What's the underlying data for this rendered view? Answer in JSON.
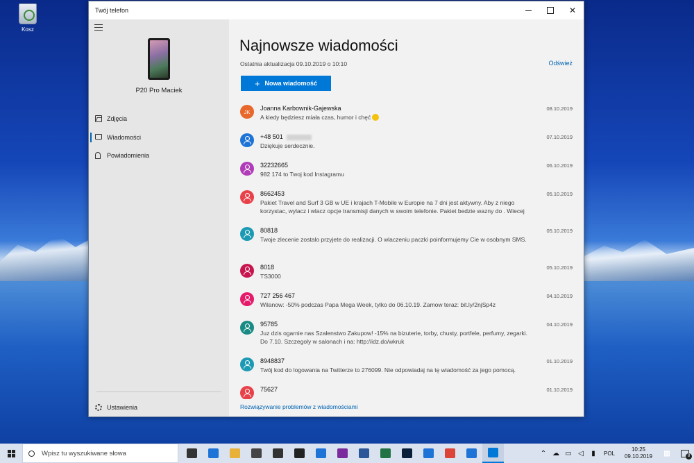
{
  "desktop": {
    "recycle_bin_label": "Kosz"
  },
  "window": {
    "title": "Twój telefon",
    "close_glyph": "✕"
  },
  "sidebar": {
    "device_name": "P20 Pro Maciek",
    "nav": [
      {
        "label": "Zdjęcia",
        "icon": "photos-icon"
      },
      {
        "label": "Wiadomości",
        "icon": "message-icon",
        "active": true
      },
      {
        "label": "Powiadomienia",
        "icon": "bell-icon"
      }
    ],
    "settings_label": "Ustawienia"
  },
  "main": {
    "title": "Najnowsze wiadomości",
    "last_update": "Ostatnia aktualizacja 09.10.2019 o 10:10",
    "refresh_label": "Odśwież",
    "new_message_label": "Nowa wiadomość",
    "troubleshoot_label": "Rozwiązywanie problemów z wiadomościami",
    "messages": [
      {
        "sender": "Joanna Karbownik-Gajewska",
        "initials": "JK",
        "color": "#e8672a",
        "date": "08.10.2019",
        "preview": "A kiedy będziesz miała czas, humor i chęć",
        "emoji": true
      },
      {
        "sender": "+48 501",
        "blurred": true,
        "color": "#1e73d6",
        "date": "07.10.2019",
        "preview": "Dziękuje serdecznie."
      },
      {
        "sender": "32232665",
        "color": "#b03cb8",
        "date": "06.10.2019",
        "preview": "982 174 to Twoj kod Instagramu"
      },
      {
        "sender": "8662453",
        "color": "#e8414a",
        "date": "05.10.2019",
        "preview": "Pakiet Travel and Surf 3 GB w UE i krajach T-Mobile w Europie na 7 dni jest aktywny. Aby z niego korzystac, wylacz i wlacz opcje transmisji danych w swoim telefonie. Pakiet bedzie wazny do . Wiecej"
      },
      {
        "sender": "80818",
        "color": "#1d9ab3",
        "date": "05.10.2019",
        "preview": "Twoje zlecenie zostalo przyjete do realizacji. O wlaczeniu paczki poinformujemy Cie w osobnym SMS."
      },
      {
        "sender": "8018",
        "color": "#c8154f",
        "date": "05.10.2019",
        "preview": "TS3000"
      },
      {
        "sender": "727 256 467",
        "color": "#e51a6a",
        "date": "04.10.2019",
        "preview": "Wilanow: -50% podczas Papa Mega Week, tylko do 06.10.19. Zamow teraz: bit.ly/2njSp4z"
      },
      {
        "sender": "95785",
        "color": "#1a8a84",
        "date": "04.10.2019",
        "preview": "Juz dzis ogarnie nas Szalenstwo Zakupow! -15% na bizuterie, torby, chusty, portfele, perfumy, zegarki. Do 7.10. Szczegoly w salonach i na: http://idz.do/wkruk"
      },
      {
        "sender": "8948837",
        "color": "#1d9ab3",
        "date": "01.10.2019",
        "preview": "Twój kod do logowania na Twitterze to 276099. Nie odpowiadaj na tę wiadomość za jego pomocą."
      },
      {
        "sender": "75627",
        "color": "#e8414a",
        "date": "01.10.2019",
        "preview": ""
      }
    ]
  },
  "taskbar": {
    "search_placeholder": "Wpisz tu wyszukiwane słowa",
    "apps": [
      {
        "name": "task-view-icon",
        "color": "#333333"
      },
      {
        "name": "edge-icon",
        "color": "#1e73d6"
      },
      {
        "name": "file-explorer-icon",
        "color": "#e8b23a"
      },
      {
        "name": "mail-icon",
        "color": "#444444"
      },
      {
        "name": "calendar-icon",
        "color": "#333333"
      },
      {
        "name": "people-icon",
        "color": "#222222"
      },
      {
        "name": "skype-icon",
        "color": "#1e73d6"
      },
      {
        "name": "onenote-icon",
        "color": "#7a2a9c"
      },
      {
        "name": "word-icon",
        "color": "#2b579a"
      },
      {
        "name": "excel-icon",
        "color": "#217346"
      },
      {
        "name": "photoshop-icon",
        "color": "#0a1f3a"
      },
      {
        "name": "paint-icon",
        "color": "#1e73d6"
      },
      {
        "name": "chrome-icon",
        "color": "#db4437"
      },
      {
        "name": "tasks-icon",
        "color": "#1e73d6"
      },
      {
        "name": "your-phone-icon",
        "color": "#0078d7",
        "active": true
      }
    ],
    "language": "POL",
    "time": "10:25",
    "date": "09.10.2019",
    "notification_count": "8"
  }
}
